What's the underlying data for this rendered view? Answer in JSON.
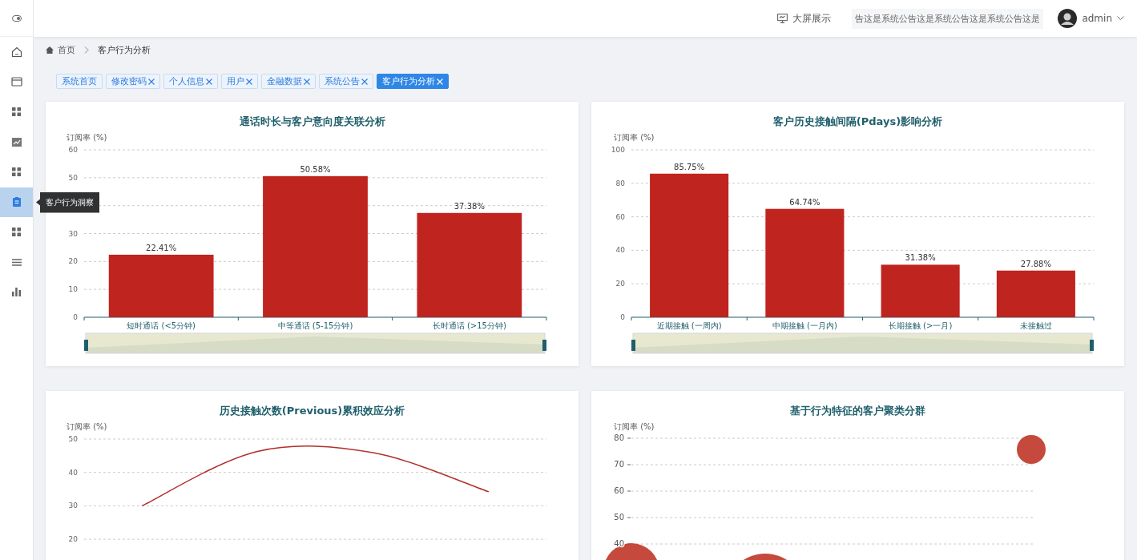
{
  "sidebar": {
    "items": [
      {
        "kind": "home",
        "selected": false
      },
      {
        "kind": "card",
        "selected": false
      },
      {
        "kind": "grid",
        "selected": false
      },
      {
        "kind": "trend",
        "selected": false
      },
      {
        "kind": "grid",
        "selected": false
      },
      {
        "kind": "clipboard",
        "selected": true
      },
      {
        "kind": "grid",
        "selected": false
      },
      {
        "kind": "list",
        "selected": false
      },
      {
        "kind": "bars",
        "selected": false
      }
    ],
    "tooltip": "客户行为洞察"
  },
  "header": {
    "big_screen": "大屏展示",
    "notice": "告这是系统公告这是系统公告这是系统公告这是",
    "user": "admin"
  },
  "breadcrumb": [
    "首页",
    "客户行为分析"
  ],
  "tabs": [
    {
      "label": "系统首页",
      "closable": false,
      "selected": false
    },
    {
      "label": "修改密码",
      "closable": true,
      "selected": false
    },
    {
      "label": "个人信息",
      "closable": true,
      "selected": false
    },
    {
      "label": "用户",
      "closable": true,
      "selected": false
    },
    {
      "label": "金融数据",
      "closable": true,
      "selected": false
    },
    {
      "label": "系统公告",
      "closable": true,
      "selected": false
    },
    {
      "label": "客户行为分析",
      "closable": true,
      "selected": true
    }
  ],
  "cards": [
    {
      "title": "通话时长与客户意向度关联分析",
      "chart_data": {
        "type": "bar",
        "ylabel": "订阅率 (%)",
        "categories": [
          "短时通话 (<5分钟)",
          "中等通话 (5-15分钟)",
          "长时通话 (>15分钟)"
        ],
        "series": [
          {
            "color": "#c0241f",
            "values": [
              22.41,
              50.58,
              37.38
            ]
          }
        ],
        "ylim": [
          0,
          60
        ],
        "yticks": [
          0,
          10,
          20,
          30,
          50,
          60
        ],
        "grid": true,
        "value_labels": [
          "22.41%",
          "50.58%",
          "37.38%"
        ]
      }
    },
    {
      "title": "客户历史接触间隔(Pdays)影响分析",
      "chart_data": {
        "type": "bar",
        "ylabel": "订阅率 (%)",
        "categories": [
          "近期接触 (一周内)",
          "中期接触 (一月内)",
          "长期接触 (>一月)",
          "未接触过"
        ],
        "series": [
          {
            "color": "#c0241f",
            "values": [
              85.75,
              64.74,
              31.38,
              27.88
            ]
          }
        ],
        "ylim": [
          0,
          100
        ],
        "yticks": [
          0,
          20,
          40,
          60,
          80,
          100
        ],
        "grid": true,
        "value_labels": [
          "85.75%",
          "64.74%",
          "31.38%",
          "27.88%"
        ]
      }
    },
    {
      "title": "历史接触次数(Previous)累积效应分析",
      "chart_data": {
        "type": "line",
        "ylabel": "订阅率 (%)",
        "series": [
          {
            "color": "#b0302a",
            "values": [
              30,
              46.3,
              45.9,
              34.2
            ]
          }
        ],
        "ylim": [
          20,
          50
        ],
        "yticks": [
          20,
          30,
          40,
          50
        ],
        "grid": true
      }
    },
    {
      "title": "基于行为特征的客户聚类分群",
      "bubble_chart": {
        "ylabel": "订阅率 (%)",
        "yticks": [
          "80",
          "70",
          "60",
          "50",
          "40"
        ]
      }
    }
  ]
}
